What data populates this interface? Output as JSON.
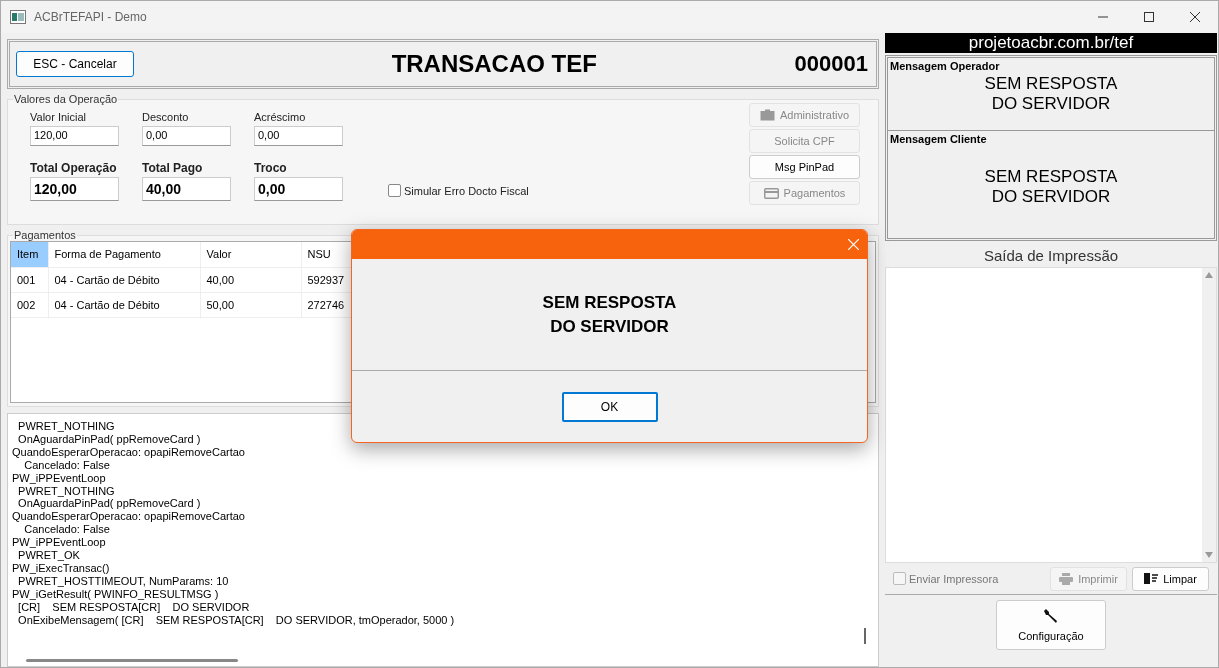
{
  "window": {
    "title": "ACBrTEFAPI - Demo"
  },
  "header": {
    "cancel_button": "ESC - Cancelar",
    "title": "TRANSACAO TEF",
    "number": "000001"
  },
  "valores": {
    "legend": "Valores da Operação",
    "fields": [
      {
        "label": "Valor Inicial",
        "value": "120,00",
        "kind": "plain"
      },
      {
        "label": "Desconto",
        "value": "0,00",
        "kind": "plain"
      },
      {
        "label": "Acréscimo",
        "value": "0,00",
        "kind": "plain"
      },
      {
        "label": "Total Operação",
        "value": "120,00",
        "kind": "total"
      },
      {
        "label": "Total Pago",
        "value": "40,00",
        "kind": "total"
      },
      {
        "label": "Troco",
        "value": "0,00",
        "kind": "total"
      }
    ],
    "checkbox": {
      "label": "Simular Erro Docto Fiscal",
      "checked": false
    },
    "buttons": [
      {
        "label": "Administrativo",
        "kind": "briefcase",
        "disabled": true
      },
      {
        "label": "Solicita CPF",
        "kind": "plain",
        "disabled": true
      },
      {
        "label": "Msg PinPad",
        "kind": "plain",
        "disabled": false
      },
      {
        "label": "Pagamentos",
        "kind": "card",
        "disabled": true
      }
    ]
  },
  "pagamentos": {
    "legend": "Pagamentos",
    "columns": [
      {
        "label": "Item",
        "selected": true
      },
      {
        "label": "Forma de Pagamento",
        "selected": false
      },
      {
        "label": "Valor",
        "selected": false
      },
      {
        "label": "NSU",
        "selected": false
      }
    ],
    "rows": [
      [
        "001",
        "04 - Cartão de Débito",
        "40,00",
        "592937"
      ],
      [
        "002",
        "04 - Cartão de Débito",
        "50,00",
        "272746"
      ]
    ]
  },
  "log": [
    "  PWRET_NOTHING",
    "  OnAguardaPinPad( ppRemoveCard )",
    "QuandoEsperarOperacao: opapiRemoveCartao",
    "    Cancelado: False",
    "PW_iPPEventLoop",
    "  PWRET_NOTHING",
    "  OnAguardaPinPad( ppRemoveCard )",
    "QuandoEsperarOperacao: opapiRemoveCartao",
    "    Cancelado: False",
    "PW_iPPEventLoop",
    "  PWRET_OK",
    "PW_iExecTransac()",
    "  PWRET_HOSTTIMEOUT, NumParams: 10",
    "PW_iGetResult( PWINFO_RESULTMSG )",
    "  [CR]    SEM RESPOSTA[CR]    DO SERVIDOR",
    "  OnExibeMensagem( [CR]    SEM RESPOSTA[CR]    DO SERVIDOR, tmOperador, 5000 )"
  ],
  "right": {
    "banner": "projetoacbr.com.br/tef",
    "operador": {
      "label": "Mensagem Operador",
      "lines": [
        "SEM RESPOSTA",
        "DO SERVIDOR"
      ]
    },
    "cliente": {
      "label": "Mensagem Cliente",
      "lines": [
        "SEM RESPOSTA",
        "DO SERVIDOR"
      ]
    },
    "print_title": "Saída de Impressão",
    "send_printer": {
      "label": "Enviar Impressora",
      "checked": false,
      "disabled": true
    },
    "print_button": {
      "label": "Imprimir",
      "disabled": true
    },
    "clear_button": {
      "label": "Limpar",
      "disabled": false
    },
    "config_button": "Configuração"
  },
  "dialog": {
    "lines": [
      "SEM RESPOSTA",
      "DO SERVIDOR"
    ],
    "ok": "OK"
  }
}
